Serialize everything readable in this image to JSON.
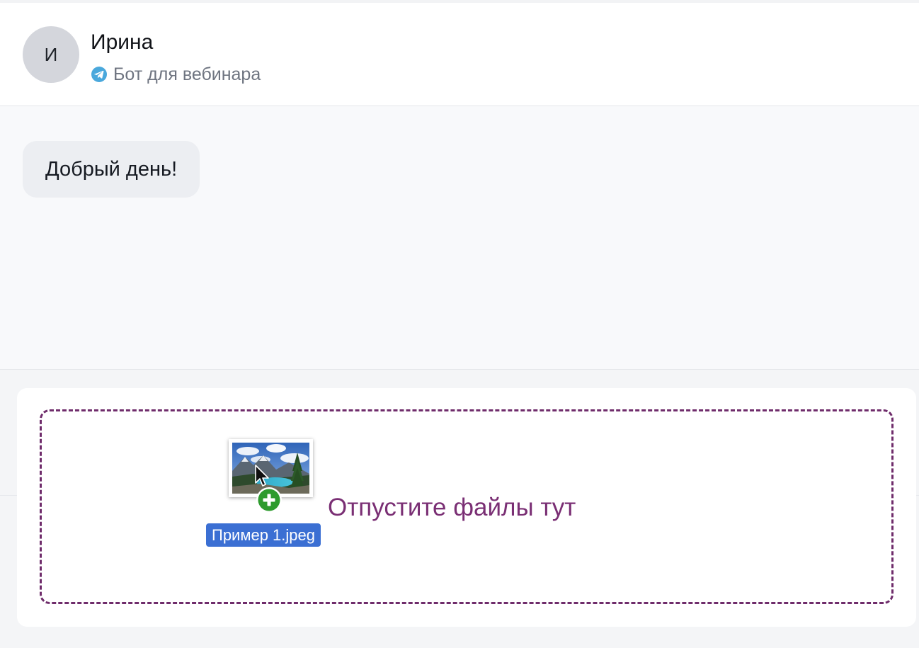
{
  "header": {
    "avatar_initial": "И",
    "contact_name": "Ирина",
    "channel_icon": "telegram-icon",
    "channel_name": "Бот для вебинара"
  },
  "messages": [
    {
      "text": "Добрый день!"
    }
  ],
  "dropzone": {
    "label": "Отпустите файлы тут",
    "dragged_file": {
      "name": "Пример 1.jpeg",
      "icon": "image-thumbnail",
      "badge_icon": "plus-icon"
    }
  },
  "colors": {
    "accent": "#7a2f74",
    "telegram": "#2aa3df",
    "drag_label": "#3b6fd3",
    "plus_badge": "#2e9b2e"
  }
}
